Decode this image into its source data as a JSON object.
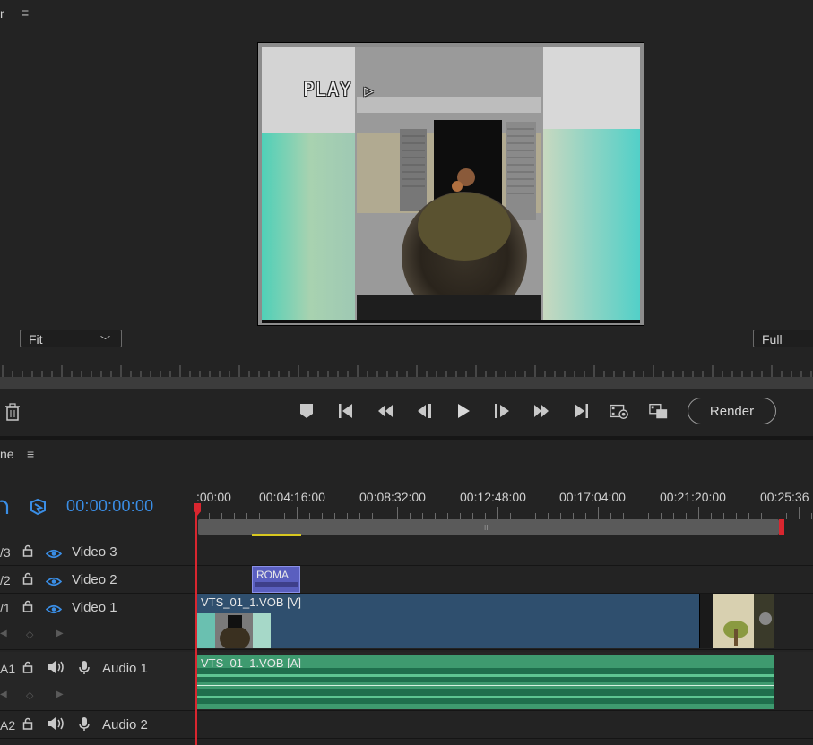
{
  "monitor": {
    "title_fragment": "r",
    "menu_icon": "≡",
    "overlay_text": "PLAY",
    "fit_select": "Fit",
    "quality_select": "Full",
    "render_label": "Render"
  },
  "timeline": {
    "title_fragment": "ne",
    "menu_icon": "≡",
    "timecode": "00:00:00:00",
    "ruler_labels": [
      ":00:00",
      "00:04:16:00",
      "00:08:32:00",
      "00:12:48:00",
      "00:17:04:00",
      "00:21:20:00",
      "00:25:36"
    ],
    "tracks": [
      {
        "id": "/3",
        "name": "Video 3"
      },
      {
        "id": "/2",
        "name": "Video 2"
      },
      {
        "id": "/1",
        "name": "Video 1"
      },
      {
        "id": "A1",
        "name": "Audio 1"
      },
      {
        "id": "A2",
        "name": "Audio 2"
      }
    ],
    "clips": {
      "title_clip": "ROMA",
      "video_clip": "VTS_01_1.VOB [V]",
      "audio_clip": "VTS_01_1.VOB [A]"
    }
  },
  "colors": {
    "accent_blue": "#3a8ee6",
    "playhead_red": "#d9262f",
    "video_clip": "#2f4f6e",
    "audio_clip": "#3e9a6f",
    "title_clip": "#5a5fbf"
  }
}
